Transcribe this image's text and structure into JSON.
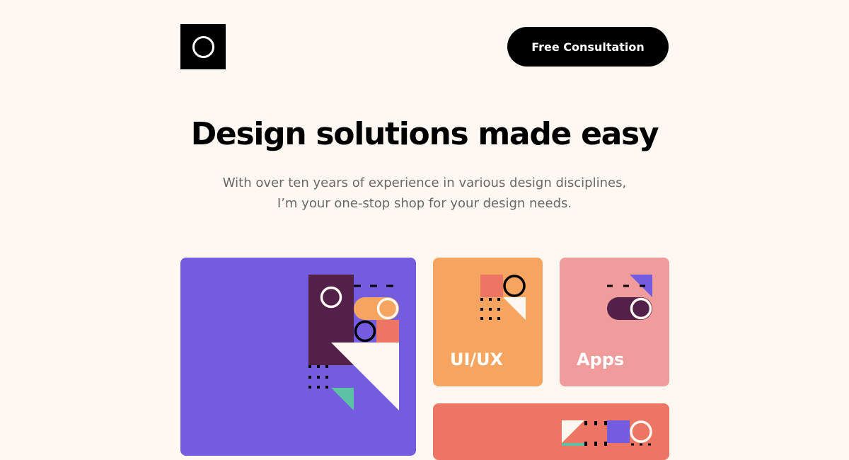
{
  "header": {
    "logo_icon": "ring-logo-icon",
    "cta_label": "Free Consultation"
  },
  "hero": {
    "title": "Design solutions made easy",
    "subtitle": "With over ten years of experience in various design disciplines, I’m your one-stop shop for your design needs."
  },
  "cards": [
    {
      "id": "main",
      "label": "",
      "color": "#745CDF"
    },
    {
      "id": "uiux",
      "label": "UI/UX",
      "color": "#F6A560"
    },
    {
      "id": "apps",
      "label": "Apps",
      "color": "#F19C9C"
    },
    {
      "id": "wide",
      "label": "",
      "color": "#EC7564"
    }
  ],
  "colors": {
    "background": "#FEF7F2",
    "text": "#000000",
    "muted_text": "#6B6865",
    "purple": "#745CDF",
    "orange": "#F6A560",
    "pink": "#F19C9C",
    "coral": "#EC7564",
    "plum": "#53204A",
    "teal": "#5DC1A6",
    "cream": "#FEF7F2"
  }
}
